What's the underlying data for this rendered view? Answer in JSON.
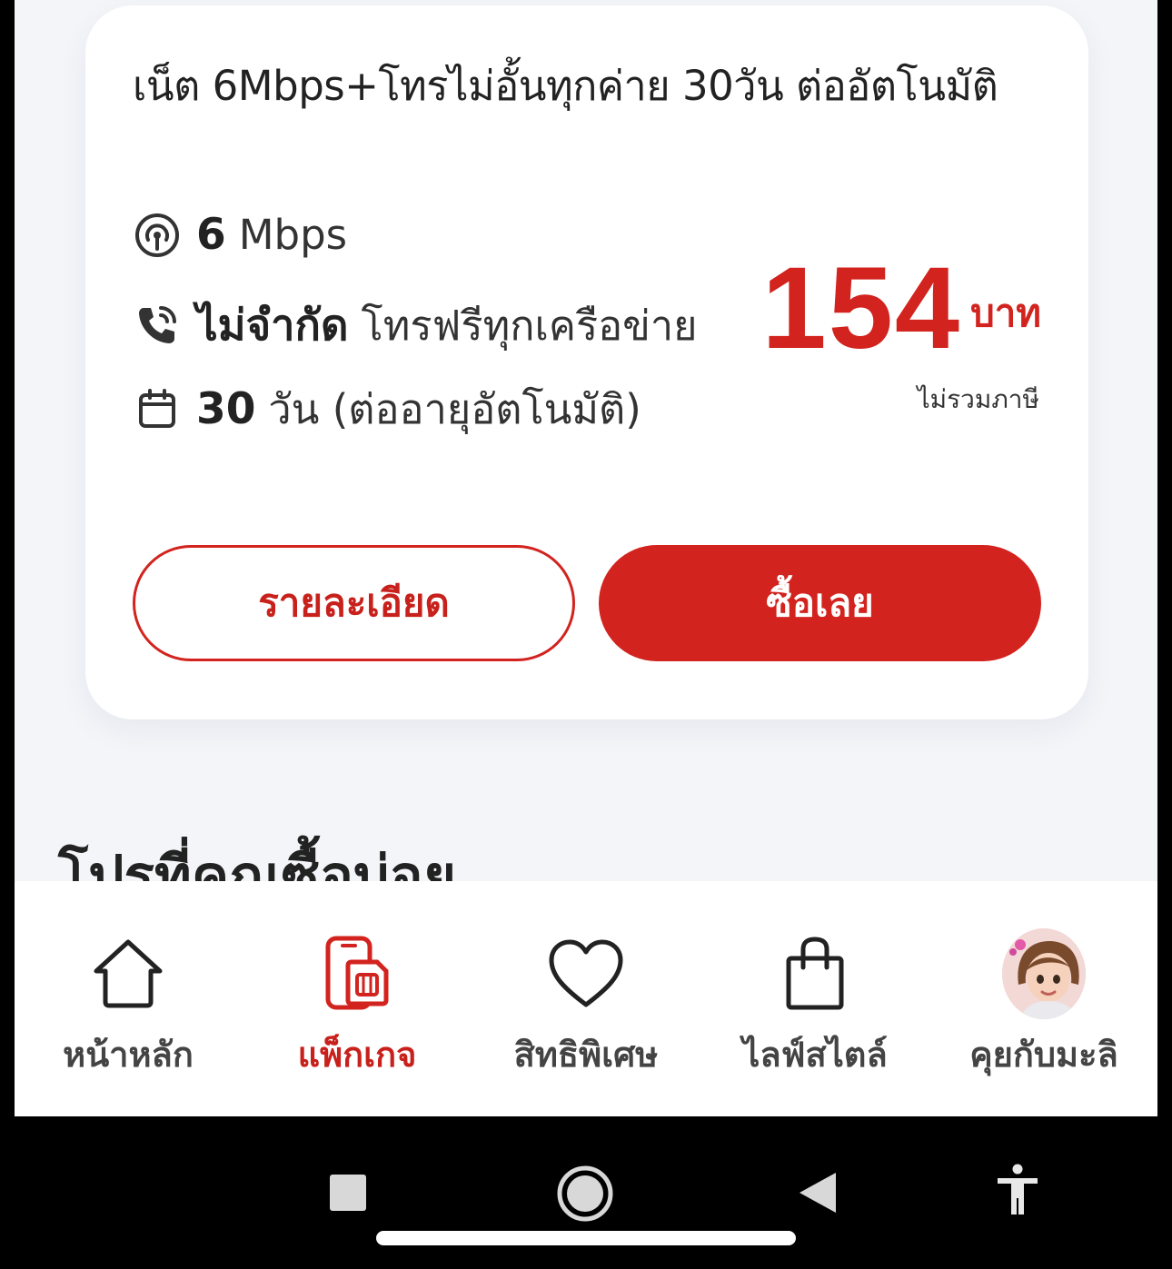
{
  "package": {
    "title": "เน็ต 6Mbps+โทรไม่อั้นทุกค่าย 30วัน ต่ออัตโนมัติ",
    "features": [
      {
        "icon": "signal-icon",
        "bold": "6",
        "text": "Mbps"
      },
      {
        "icon": "phone-call-icon",
        "bold": "ไม่จำกัด",
        "text": "โทรฟรีทุกเครือข่าย"
      },
      {
        "icon": "calendar-icon",
        "bold": "30",
        "text": "วัน (ต่ออายุอัตโนมัติ)"
      }
    ],
    "price": "154",
    "price_unit": "บาท",
    "vat_note": "ไม่รวมภาษี",
    "detail_button": "รายละเอียด",
    "buy_button": "ซื้อเลย"
  },
  "section": {
    "title": "โปรที่คุณซื้อบ่อย"
  },
  "bottom_nav": {
    "items": [
      {
        "label": "หน้าหลัก",
        "icon": "home-icon",
        "active": false
      },
      {
        "label": "แพ็กเกจ",
        "icon": "sim-package-icon",
        "active": true
      },
      {
        "label": "สิทธิพิเศษ",
        "icon": "heart-icon",
        "active": false
      },
      {
        "label": "ไลฟ์สไตล์",
        "icon": "shopping-bag-icon",
        "active": false
      },
      {
        "label": "คุยกับมะลิ",
        "icon": "avatar-icon",
        "active": false
      }
    ]
  },
  "colors": {
    "accent": "#d2231e",
    "background": "#f4f5f9"
  }
}
